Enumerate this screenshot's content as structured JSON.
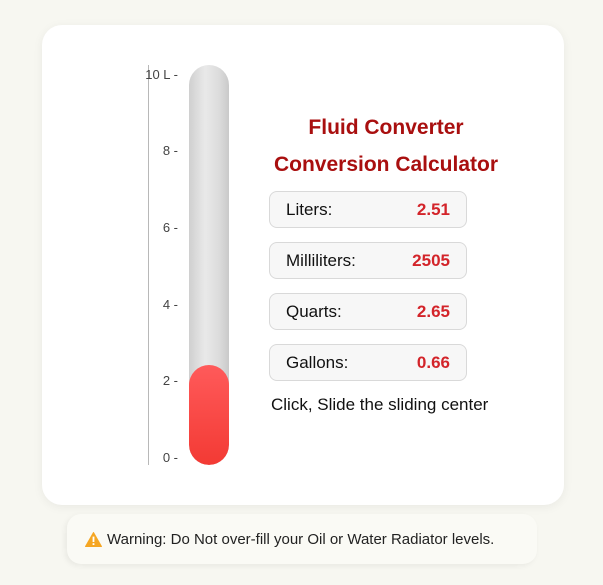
{
  "scale": {
    "ticks": [
      "10 L -",
      "8 -",
      "6 -",
      "4 -",
      "2 -",
      "0 -"
    ]
  },
  "gauge": {
    "level_liters": 2.505,
    "max_liters": 10
  },
  "converter": {
    "title": "Fluid Converter",
    "subtitle": "Conversion Calculator",
    "rows": [
      {
        "label": "Liters:",
        "value": "2.51"
      },
      {
        "label": "Milliliters:",
        "value": "2505"
      },
      {
        "label": "Quarts:",
        "value": "2.65"
      },
      {
        "label": "Gallons:",
        "value": "0.66"
      }
    ],
    "hint": "Click, Slide the sliding center"
  },
  "warning": {
    "icon": "warning-icon",
    "text": "Warning: Do Not over-fill your Oil or Water Radiator levels."
  },
  "colors": {
    "title": "#a90f0f",
    "value": "#d3242a",
    "fill": "#f33a34",
    "warning_icon": "#f5a623"
  }
}
